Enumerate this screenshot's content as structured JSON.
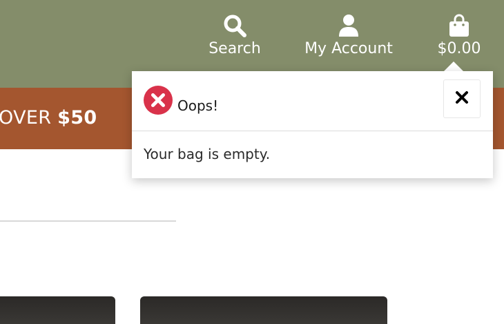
{
  "header": {
    "nav": [
      {
        "label": "Search",
        "icon": "search-icon"
      },
      {
        "label": "My Account",
        "icon": "user-icon"
      },
      {
        "label": "$0.00",
        "icon": "shopping-bag-icon"
      }
    ]
  },
  "promo": {
    "text_prefix": "OVER",
    "text_amount": "$50"
  },
  "popup": {
    "title": "Oops!",
    "message": "Your bag is empty.",
    "status_icon": "error-icon",
    "close_icon": "close-icon"
  },
  "colors": {
    "header_bg": "#848d6a",
    "promo_bg": "#a4562f",
    "error_red": "#d9324a"
  }
}
